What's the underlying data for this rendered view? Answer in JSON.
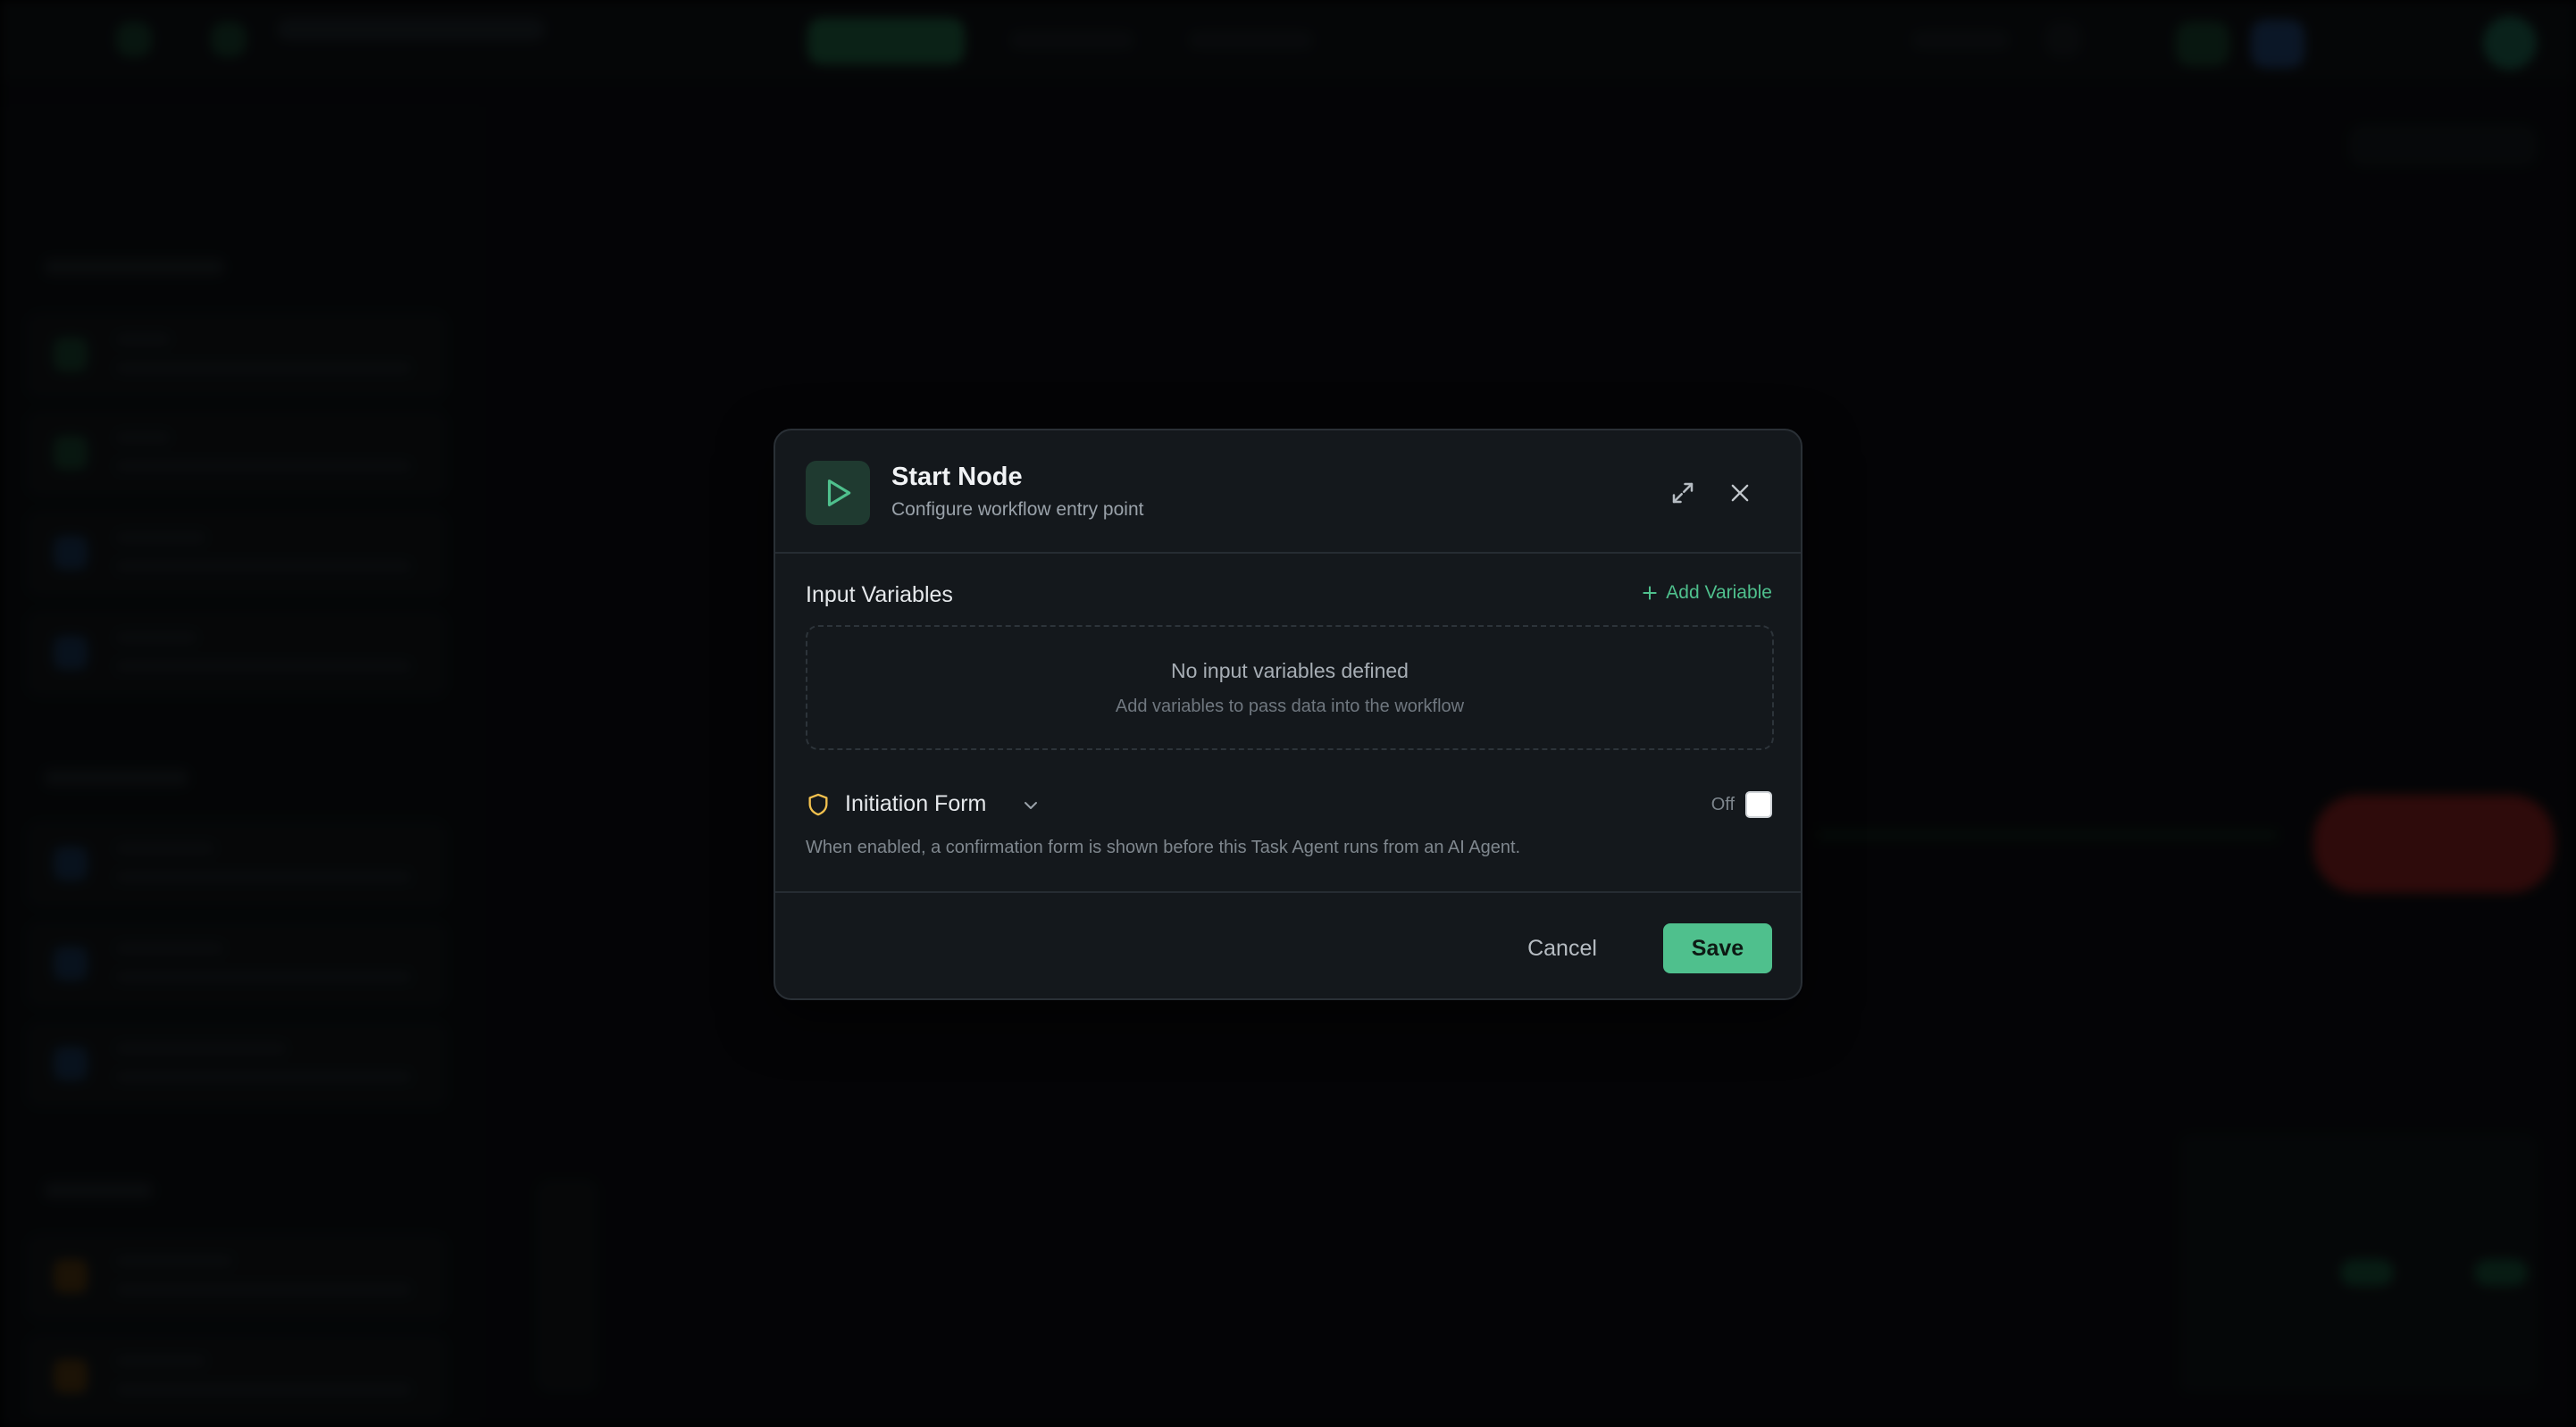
{
  "modal": {
    "title": "Start Node",
    "subtitle": "Configure workflow entry point",
    "header_icon": "play-icon",
    "expand_icon": "expand-icon",
    "close_icon": "close-icon"
  },
  "input_variables": {
    "title": "Input Variables",
    "add_label": "Add Variable",
    "empty_title": "No input variables defined",
    "empty_subtitle": "Add variables to pass data into the workflow"
  },
  "initiation_form": {
    "label": "Initiation Form",
    "icon": "shield-icon",
    "toggle_label": "Off",
    "enabled": false,
    "description": "When enabled, a confirmation form is shown before this Task Agent runs from an AI Agent."
  },
  "footer": {
    "cancel_label": "Cancel",
    "save_label": "Save"
  },
  "colors": {
    "accent": "#4fc08d",
    "modal_bg": "#14181c",
    "shield": "#f2c14e"
  }
}
